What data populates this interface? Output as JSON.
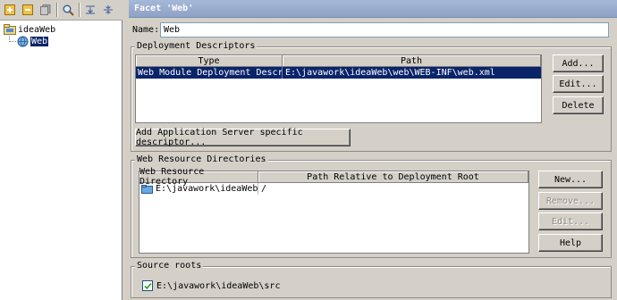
{
  "toolbar": {
    "icons": [
      "add-icon",
      "remove-icon",
      "copy-icon",
      "find-icon",
      "expand-all-icon",
      "collapse-all-icon"
    ]
  },
  "tree": {
    "root_label": "ideaWeb",
    "child_label": "Web"
  },
  "facet": {
    "header": "Facet 'Web'",
    "name_label": "Name:",
    "name_value": "Web"
  },
  "deployment": {
    "title": "Deployment Descriptors",
    "columns": [
      "Type",
      "Path"
    ],
    "rows": [
      {
        "type": "Web Module Deployment Descriptor",
        "path": "E:\\javawork\\ideaWeb\\web\\WEB-INF\\web.xml"
      }
    ],
    "add_label": "Add...",
    "edit_label": "Edit...",
    "delete_label": "Delete",
    "server_descriptor_label": "Add Application Server specific descriptor..."
  },
  "resources": {
    "title": "Web Resource Directories",
    "columns": [
      "Web Resource Directory",
      "Path Relative to Deployment Root"
    ],
    "rows": [
      {
        "directory": "E:\\javawork\\ideaWeb\\web",
        "relative": "/"
      }
    ],
    "new_label": "New...",
    "remove_label": "Remove...",
    "edit_label": "Edit...",
    "help_label": "Help"
  },
  "source_roots": {
    "title": "Source roots",
    "items": [
      {
        "path": "E:\\javawork\\ideaWeb\\src",
        "checked": true
      }
    ]
  },
  "colors": {
    "selection": "#0a246a",
    "panel": "#d4d0c8",
    "header": "#a6b8d8"
  }
}
